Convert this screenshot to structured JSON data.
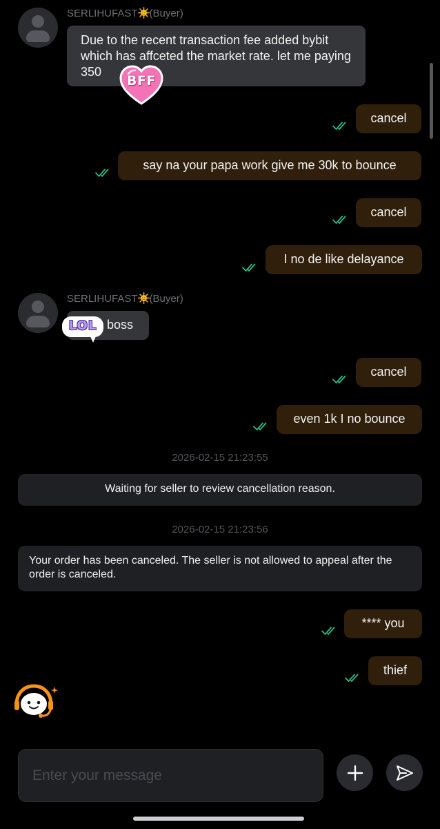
{
  "messages": {
    "m1": {
      "sender": "SERLIHUFAST",
      "role": "(Buyer)",
      "text": "Due to the recent transaction fee added bybit which has affceted the market rate. let me paying 350",
      "sticker": "BFF"
    },
    "m2": {
      "text": "cancel"
    },
    "m3": {
      "text": "say na your papa work give me 30k to bounce"
    },
    "m4": {
      "text": "cancel"
    },
    "m5": {
      "text": "I no de like delayance"
    },
    "m6": {
      "sender": "SERLIHUFAST",
      "role": "(Buyer)",
      "text": "boss",
      "sticker": "LOL"
    },
    "m7": {
      "text": "cancel"
    },
    "m8": {
      "text": "even 1k I no bounce"
    },
    "m9": {
      "text": "**** you"
    },
    "m10": {
      "text": "thief"
    }
  },
  "system": {
    "s1": {
      "timestamp": "2026-02-15 21:23:55",
      "text": "Waiting for seller to review cancellation reason."
    },
    "s2": {
      "timestamp": "2026-02-15 21:23:56",
      "text": "Your order has been canceled. The seller is not allowed to appeal after the order is canceled."
    }
  },
  "composer": {
    "placeholder": "Enter your message"
  },
  "icons": {
    "avatar": "default-avatar-icon",
    "sun": "sun-emoji-icon",
    "read_receipt": "double-check-icon",
    "support": "support-bot-icon",
    "add": "plus-icon",
    "send": "send-icon"
  },
  "colors": {
    "background": "#000000",
    "incoming_bubble": "#35363a",
    "outgoing_bubble": "#2f1f0b",
    "read_tick": "#2ebd85",
    "system_bubble": "#1f2024"
  }
}
